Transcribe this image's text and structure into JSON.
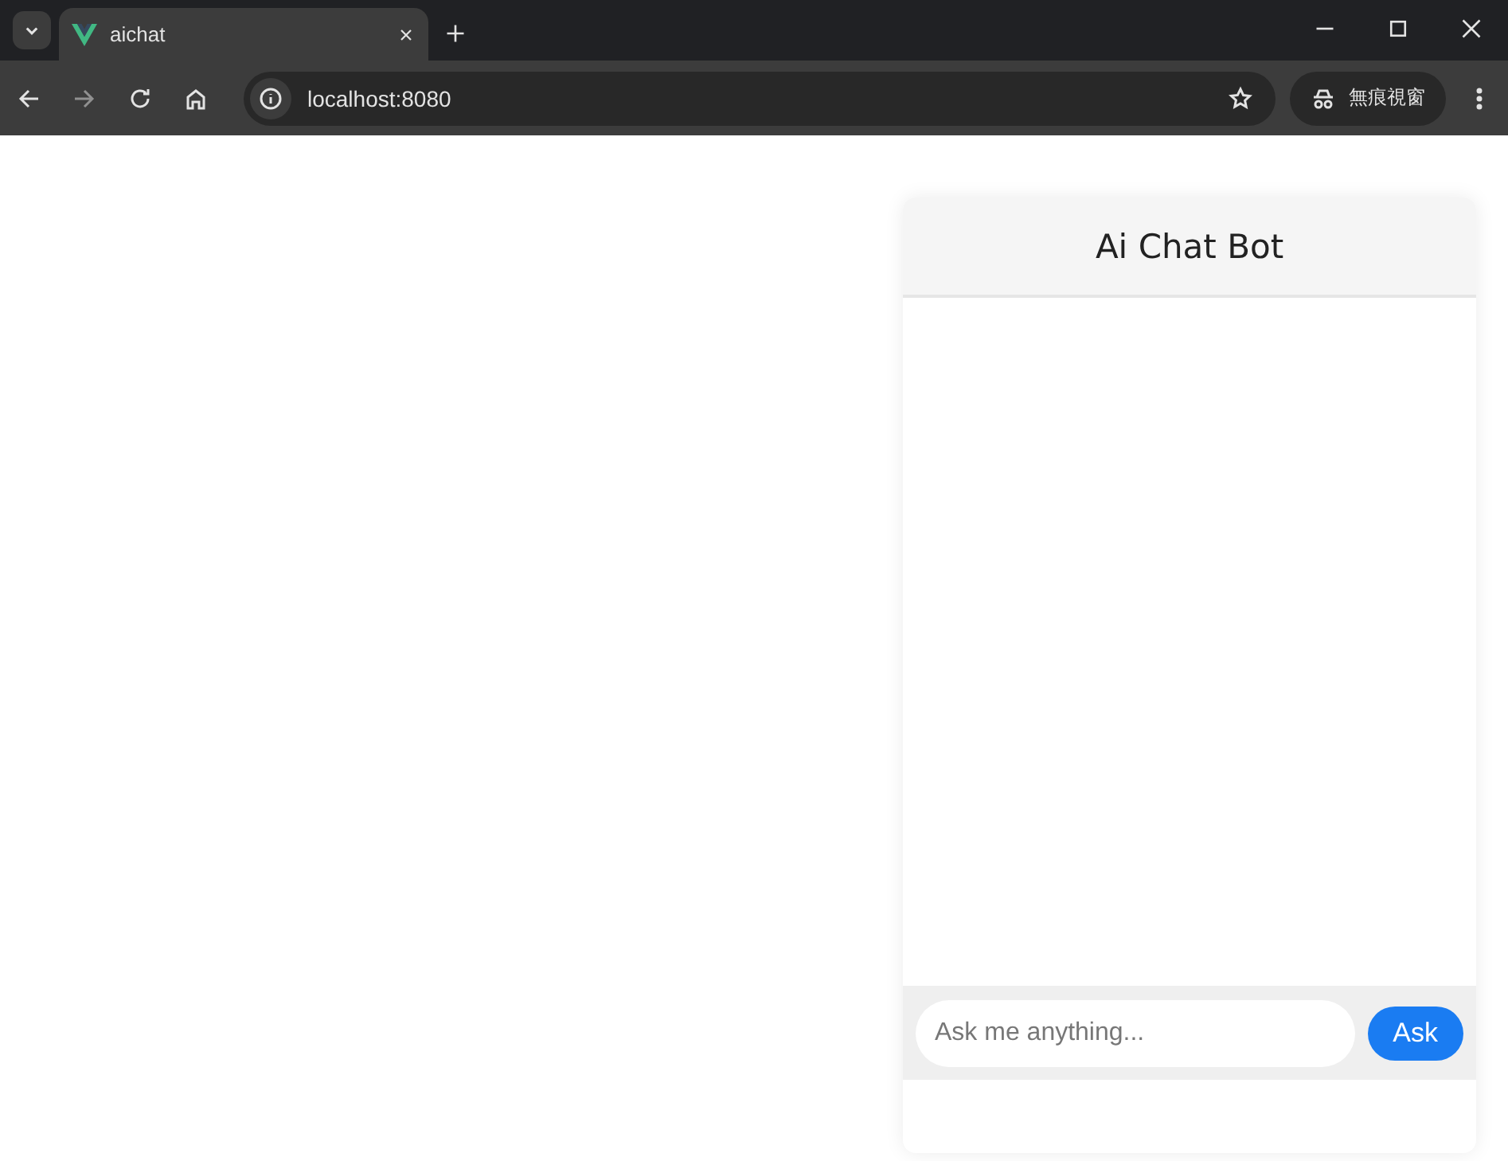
{
  "browser": {
    "tab": {
      "title": "aichat",
      "selected": true
    },
    "address": "localhost:8080",
    "profile": "無痕視窗"
  },
  "chat": {
    "title": "Ai Chat Bot",
    "input": {
      "placeholder": "Ask me anything..."
    },
    "send_button": "Ask"
  }
}
